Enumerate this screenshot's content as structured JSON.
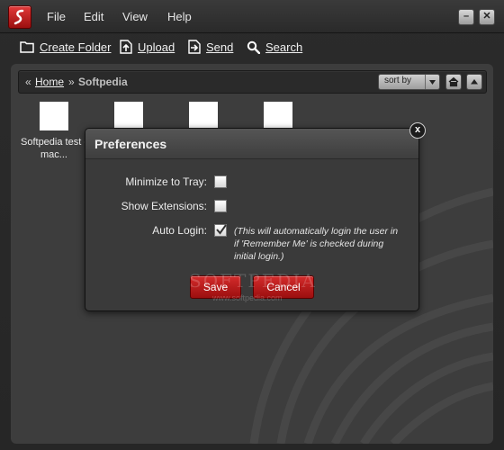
{
  "menubar": {
    "items": [
      "File",
      "Edit",
      "View",
      "Help"
    ],
    "minimize_glyph": "–",
    "close_glyph": "✕"
  },
  "toolbar": {
    "create_folder": "Create Folder",
    "upload": "Upload",
    "send": "Send",
    "search": "Search"
  },
  "breadcrumb": {
    "prefix": "«",
    "home": "Home",
    "separator": "»",
    "current": "Softpedia"
  },
  "sort": {
    "value": "sort by"
  },
  "files": [
    {
      "name": "Softpedia test - mac..."
    },
    {
      "name": ""
    },
    {
      "name": ""
    },
    {
      "name": ""
    }
  ],
  "dialog": {
    "title": "Preferences",
    "close_glyph": "x",
    "rows": [
      {
        "label": "Minimize to Tray:",
        "checked": false
      },
      {
        "label": "Show Extensions:",
        "checked": false
      },
      {
        "label": "Auto Login:",
        "checked": true
      }
    ],
    "note": "(This will automatically login the user in if 'Remember Me' is checked during initial login.)",
    "save": "Save",
    "cancel": "Cancel"
  },
  "watermark": {
    "text": "SOFTPEDIA",
    "url": "www.softpedia.com"
  },
  "colors": {
    "accent_red": "#c31f1f",
    "panel_bg": "#3d3d3d",
    "chrome_bg": "#2a2a2a"
  }
}
